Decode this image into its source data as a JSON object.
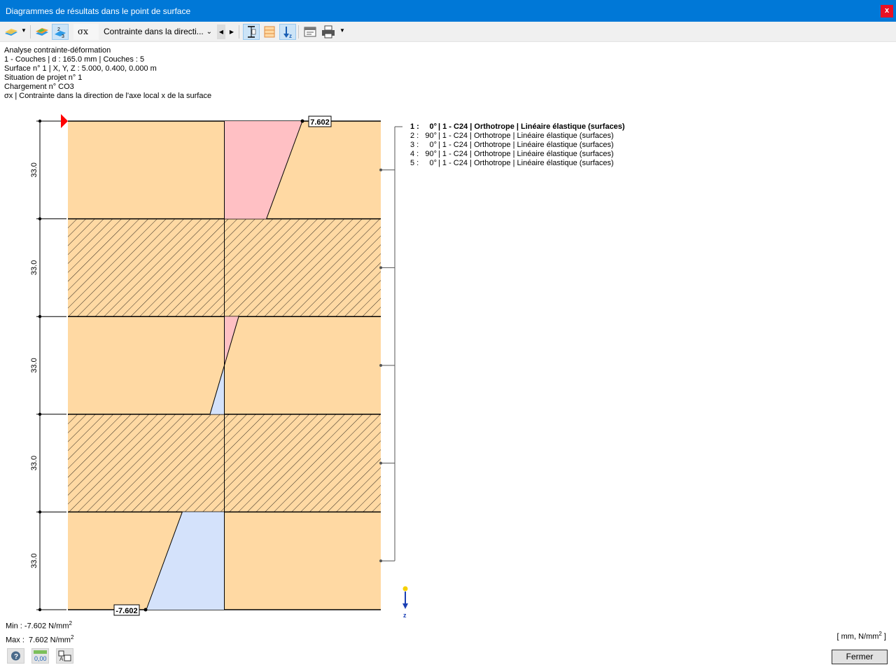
{
  "window": {
    "title": "Diagrammes de résultats dans le point de surface",
    "close_label": "x"
  },
  "toolbar": {
    "symbol": "σx",
    "result_type": "Contrainte dans la directi...",
    "icons": [
      "surface-results-icon",
      "dropdown-arrow-icon",
      "surface-color-icon",
      "layer-numbers-icon",
      "prev-icon",
      "next-icon",
      "thickness-dimension-icon",
      "layers-icon",
      "z-axis-direction-icon",
      "export-icon",
      "print-icon",
      "print-dropdown-icon"
    ]
  },
  "info": {
    "line1": "Analyse contrainte-déformation",
    "line2": "1 - Couches | d : 165.0 mm | Couches : 5",
    "line3": "Surface n° 1 | X, Y, Z : 5.000, 0.400, 0.000 m",
    "line4": "Situation de projet n° 1",
    "line5": "Chargement n° CO3",
    "line6": "σx | Contrainte dans la direction de l'axe local x de la surface"
  },
  "diagram": {
    "layer_thickness_label": "33.0",
    "max_label": "7.602",
    "min_label": "-7.602",
    "z_axis_label": "z",
    "colors": {
      "layer_fill": "#ffd9a3",
      "positive_fill": "#ffc0c4",
      "negative_fill": "#d4e2fb",
      "hatch": "#000000",
      "pointer": "#ff0000"
    }
  },
  "layers": [
    {
      "index": "1 :",
      "angle": "0°",
      "text": "| 1 - C24 | Orthotrope | Linéaire élastique (surfaces)",
      "selected": true,
      "hatched": false
    },
    {
      "index": "2 :",
      "angle": "90°",
      "text": "| 1 - C24 | Orthotrope | Linéaire élastique (surfaces)",
      "selected": false,
      "hatched": true
    },
    {
      "index": "3 :",
      "angle": "0°",
      "text": "| 1 - C24 | Orthotrope | Linéaire élastique (surfaces)",
      "selected": false,
      "hatched": false
    },
    {
      "index": "4 :",
      "angle": "90°",
      "text": "| 1 - C24 | Orthotrope | Linéaire élastique (surfaces)",
      "selected": false,
      "hatched": true
    },
    {
      "index": "5 :",
      "angle": "0°",
      "text": "| 1 - C24 | Orthotrope | Linéaire élastique (surfaces)",
      "selected": false,
      "hatched": false
    }
  ],
  "stress_values": {
    "unit": "N/mm2",
    "top_of_layer_1": 7.602,
    "bottom_of_layer_1": 4.1,
    "top_of_layer_3": 1.4,
    "bottom_of_layer_3": -1.4,
    "top_of_layer_5": -4.1,
    "bottom_of_layer_5": -7.602
  },
  "summary": {
    "min_label": "Min :",
    "min_value": "-7.602",
    "max_label": "Max :",
    "max_value": "7.602",
    "unit_text": "N/mm",
    "unit_exp": "2",
    "units_prefix": "[ mm, N/mm",
    "units_exp": "2",
    "units_suffix": " ]"
  },
  "footer": {
    "close_button": "Fermer",
    "icons": [
      "help-icon",
      "decimal-places-icon",
      "display-settings-icon"
    ]
  }
}
